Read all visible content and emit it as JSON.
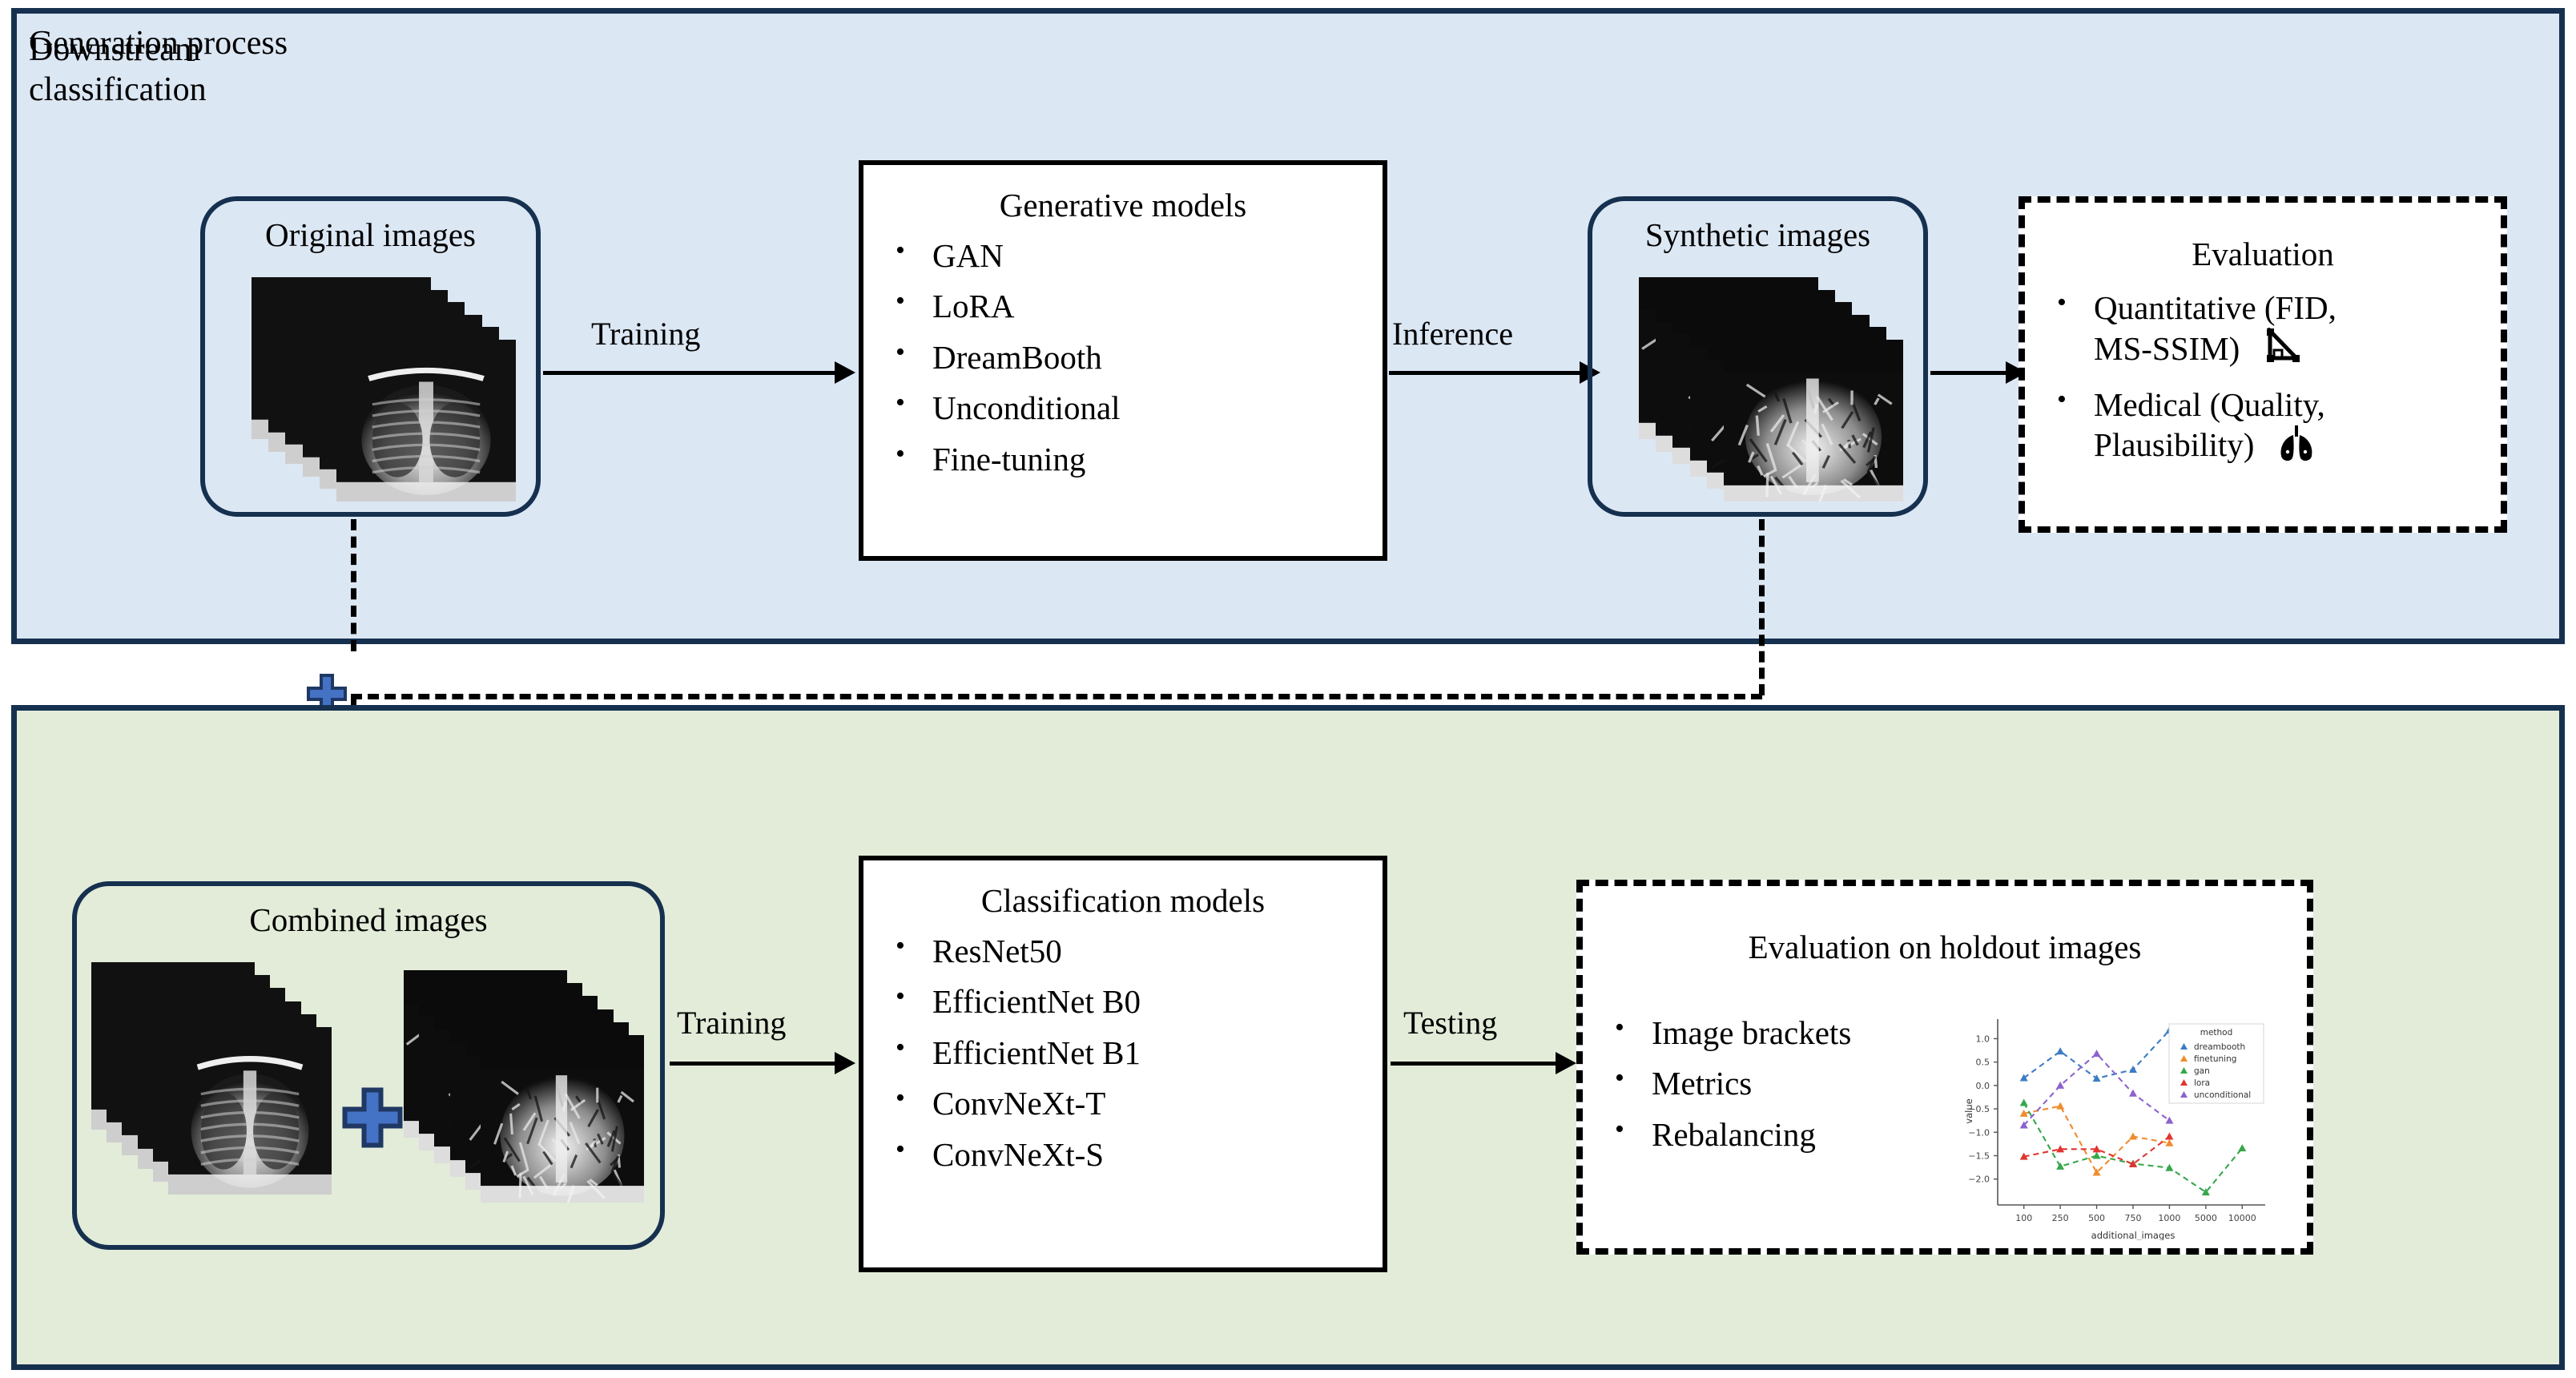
{
  "panels": {
    "generation": {
      "title": "Generation process",
      "bg": "#dce7f4",
      "border": "#16304f"
    },
    "downstream": {
      "title": "Downstream\nclassification",
      "bg": "#e2ecd9",
      "border": "#16304f"
    }
  },
  "nodes": {
    "original_images": {
      "label": "Original images"
    },
    "synthetic_images": {
      "label": "Synthetic images"
    },
    "combined_images": {
      "label": "Combined images"
    },
    "generative_models": {
      "heading": "Generative models",
      "items": [
        "GAN",
        "LoRA",
        "DreamBooth",
        "Unconditional",
        "Fine-tuning"
      ]
    },
    "classification_models": {
      "heading": "Classification models",
      "items": [
        "ResNet50",
        "EfficientNet B0",
        "EfficientNet B1",
        "ConvNeXt-T",
        "ConvNeXt-S"
      ]
    },
    "evaluation": {
      "heading": "Evaluation",
      "items": [
        "Quantitative (FID, MS-SSIM)",
        "Medical (Quality, Plausibility)"
      ],
      "item_lines": [
        [
          "Quantitative (FID,",
          "MS-SSIM)"
        ],
        [
          "Medical (Quality,",
          "Plausibility)"
        ]
      ],
      "icons": [
        "ruler-triangle-icon",
        "lungs-icon"
      ]
    },
    "holdout_evaluation": {
      "heading": "Evaluation on holdout images",
      "items": [
        "Image brackets",
        "Metrics",
        "Rebalancing"
      ]
    }
  },
  "edges": {
    "training_generation": "Training",
    "inference": "Inference",
    "training_classification": "Training",
    "testing": "Testing"
  },
  "icons": {
    "plus_merge_top": "plus-icon",
    "plus_combined": "plus-icon",
    "plus_fill": "#4472c4",
    "plus_stroke": "#1f3864"
  },
  "chart_data": {
    "type": "line",
    "title": "",
    "xlabel": "additional_images",
    "ylabel": "value",
    "categories": [
      "100",
      "250",
      "500",
      "750",
      "1000",
      "5000",
      "10000"
    ],
    "xtick_labels": [
      "100",
      "250",
      "500",
      "750",
      "1000",
      "5000",
      "10000"
    ],
    "ytick_labels": [
      "1.0",
      "0.5",
      "0.0",
      "-0.5",
      "-1.0",
      "-1.5",
      "-2.0"
    ],
    "ylim": [
      -2.45,
      1.35
    ],
    "grid": false,
    "legend_title": "method",
    "legend_position": "upper right",
    "marker": "triangle",
    "linestyle": "dashed",
    "series": [
      {
        "name": "dreambooth",
        "color": "#3b7dc4",
        "x": [
          "100",
          "250",
          "500",
          "750",
          "1000"
        ],
        "values": [
          0.16,
          0.73,
          0.15,
          0.34,
          1.18
        ]
      },
      {
        "name": "finetuning",
        "color": "#f08c2e",
        "x": [
          "100",
          "250",
          "500",
          "750",
          "1000"
        ],
        "values": [
          -0.6,
          -0.44,
          -1.86,
          -1.09,
          -1.23
        ]
      },
      {
        "name": "gan",
        "color": "#36a74b",
        "x": [
          "100",
          "250",
          "500",
          "750",
          "1000",
          "5000",
          "10000"
        ],
        "values": [
          -0.37,
          -1.73,
          -1.5,
          -1.67,
          -1.76,
          -2.28,
          -1.34
        ]
      },
      {
        "name": "lora",
        "color": "#e03531",
        "x": [
          "100",
          "250",
          "500",
          "750",
          "1000"
        ],
        "values": [
          -1.52,
          -1.36,
          -1.36,
          -1.68,
          -1.09
        ]
      },
      {
        "name": "unconditional",
        "color": "#8c62cd",
        "x": [
          "100",
          "250",
          "500",
          "750",
          "1000"
        ],
        "values": [
          -0.85,
          0.0,
          0.68,
          -0.17,
          -0.75
        ]
      }
    ]
  }
}
